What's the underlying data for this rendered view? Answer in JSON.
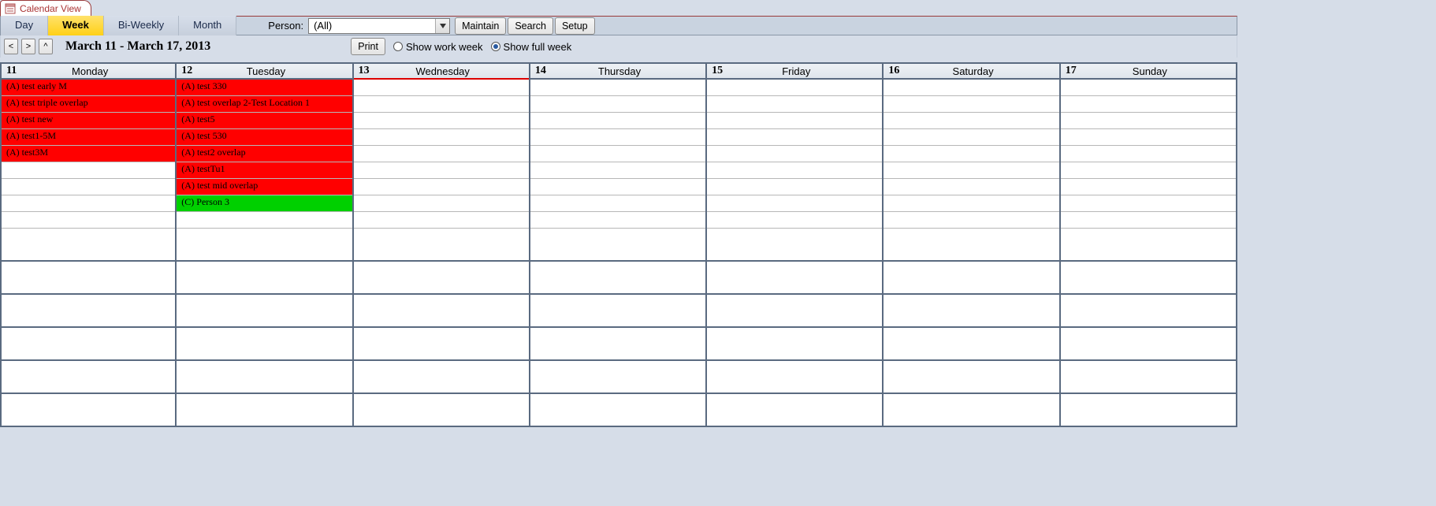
{
  "tab": {
    "title": "Calendar View"
  },
  "views": {
    "day": "Day",
    "week": "Week",
    "biweekly": "Bi-Weekly",
    "month": "Month",
    "active": "week"
  },
  "person": {
    "label": "Person:",
    "value": "(All)"
  },
  "toolbar_buttons": {
    "maintain": "Maintain",
    "search": "Search",
    "setup": "Setup"
  },
  "nav": {
    "prev": "<",
    "next": ">",
    "up": "^"
  },
  "date_range": "March 11 - March 17, 2013",
  "print_label": "Print",
  "week_mode": {
    "work": "Show work week",
    "full": "Show full week",
    "selected": "full"
  },
  "days": [
    {
      "num": "11",
      "name": "Monday"
    },
    {
      "num": "12",
      "name": "Tuesday"
    },
    {
      "num": "13",
      "name": "Wednesday"
    },
    {
      "num": "14",
      "name": "Thursday"
    },
    {
      "num": "15",
      "name": "Friday"
    },
    {
      "num": "16",
      "name": "Saturday"
    },
    {
      "num": "17",
      "name": "Sunday"
    }
  ],
  "today_index": 2,
  "events": {
    "monday": [
      {
        "text": "(A) test early M",
        "color": "red"
      },
      {
        "text": "(A) test triple overlap",
        "color": "red"
      },
      {
        "text": "(A) test new",
        "color": "red"
      },
      {
        "text": "(A) test1-5M",
        "color": "red"
      },
      {
        "text": "(A) test3M",
        "color": "red"
      }
    ],
    "tuesday": [
      {
        "text": "(A) test 330",
        "color": "red"
      },
      {
        "text": "(A) test overlap 2-Test Location 1",
        "color": "red"
      },
      {
        "text": "(A) test5",
        "color": "red"
      },
      {
        "text": "(A) test 530",
        "color": "red"
      },
      {
        "text": "(A) test2 overlap",
        "color": "red"
      },
      {
        "text": "(A) testTu1",
        "color": "red"
      },
      {
        "text": "(A) test mid overlap",
        "color": "red"
      },
      {
        "text": "(C) Person 3",
        "color": "green"
      }
    ]
  },
  "colors": {
    "red": "#ff0000",
    "green": "#00d000",
    "accent": "#c9d3e0"
  }
}
